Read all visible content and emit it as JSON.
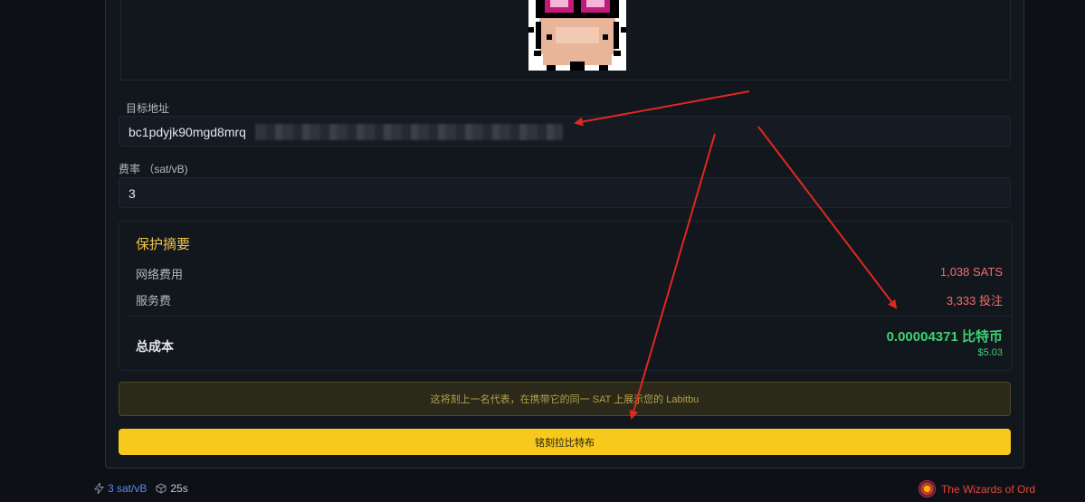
{
  "form": {
    "target_address_label": "目标地址",
    "target_address_value": "bc1pdyjk90mgd8mrq",
    "fee_rate_label": "费率 （sat/vB)",
    "fee_rate_value": "3"
  },
  "summary": {
    "title": "保护摘要",
    "network_fee_label": "网络费用",
    "network_fee_value": "1,038 SATS",
    "service_fee_label": "服务费",
    "service_fee_value": "3,333 投注",
    "total_label": "总成本",
    "total_btc": "0.00004371 比特币",
    "total_usd": "$5.03"
  },
  "notice": "这将刻上一名代表，在携带它的同一 SAT 上展示您的 Labitbu",
  "primary_button_label": "铭刻拉比特布",
  "footer": {
    "fee_rate": "3 sat/vB",
    "block_time": "25s",
    "brand_name": "The Wizards of Ord"
  },
  "colors": {
    "accent_yellow": "#f7c91c",
    "cost_red": "#f26d6d",
    "total_green": "#3fd174",
    "annotation_arrow": "#e0281f"
  },
  "icons": {
    "fee": "lightning-icon",
    "block": "cube-icon",
    "brand": "wizard-logo-icon"
  }
}
